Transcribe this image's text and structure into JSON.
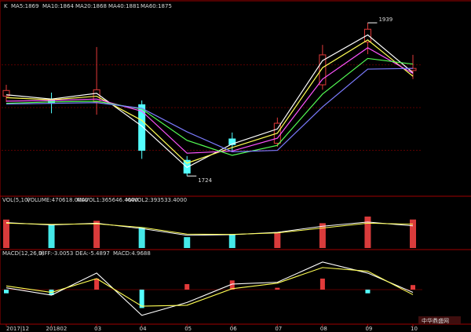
{
  "colors": {
    "up": "#e23a3a",
    "down": "#54ffff",
    "ma5": "#ffffff",
    "ma10": "#ffff54",
    "ma20": "#ff54ff",
    "ma40": "#54ff54",
    "ma60": "#7c7cff",
    "frame": "#a00000",
    "volume_bar_up": "#d93b3b",
    "volume_bar_down": "#44e8e8"
  },
  "main_panel": {
    "legend": {
      "prefix": "K",
      "ma5": "MA5:1869",
      "ma10": "MA10:1864",
      "ma20": "MA20:1868",
      "ma40": "MA40:1881",
      "ma60": "MA60:1875"
    },
    "annotations": {
      "high_label": "1939",
      "low_label": "1724"
    }
  },
  "volume_panel": {
    "legend": {
      "prefix": "VOL(5,10)",
      "volume": "VOLUME:470618.0000",
      "mavol1": "MAVOL1:365646.4000",
      "mavol2": "MAVOL2:393533.4000"
    }
  },
  "macd_panel": {
    "legend": {
      "prefix": "MACD(12,26,9)",
      "diff": "DIFF:-3.0053",
      "dea": "DEA:-5.4897",
      "macd": "MACD:4.9688"
    }
  },
  "x_axis": {
    "ticks": [
      "2017|12",
      "201802",
      "03",
      "04",
      "05",
      "06",
      "07",
      "08",
      "09",
      "10"
    ]
  },
  "watermark": "中华鼎盛网",
  "chart_data": {
    "type": "candlestick",
    "x": [
      "2017|12",
      "201802",
      "03",
      "04",
      "05",
      "06",
      "07",
      "08",
      "09",
      "10"
    ],
    "price_ylim": [
      1700,
      1960
    ],
    "price_markers": [
      {
        "label": "1939",
        "value": 1939,
        "at": "09"
      },
      {
        "label": "1724",
        "value": 1724,
        "at": "05"
      }
    ],
    "price_path_by_month": [
      {
        "x": "2017|12",
        "open": 1836,
        "close": 1844,
        "high": 1852,
        "low": 1828
      },
      {
        "x": "201802",
        "open": 1832,
        "close": 1826,
        "high": 1841,
        "low": 1812
      },
      {
        "x": "03",
        "open": 1828,
        "close": 1845,
        "high": 1905,
        "low": 1810
      },
      {
        "x": "04",
        "open": 1824,
        "close": 1760,
        "high": 1830,
        "low": 1748
      },
      {
        "x": "05",
        "open": 1746,
        "close": 1728,
        "high": 1752,
        "low": 1724
      },
      {
        "x": "06",
        "open": 1776,
        "close": 1768,
        "high": 1785,
        "low": 1758
      },
      {
        "x": "07",
        "open": 1770,
        "close": 1798,
        "high": 1806,
        "low": 1765
      },
      {
        "x": "08",
        "open": 1852,
        "close": 1894,
        "high": 1908,
        "low": 1845
      },
      {
        "x": "09",
        "open": 1912,
        "close": 1930,
        "high": 1939,
        "low": 1895
      },
      {
        "x": "10",
        "open": 1872,
        "close": 1875,
        "high": 1894,
        "low": 1860
      }
    ],
    "series": [
      {
        "name": "MA5",
        "values": [
          1838,
          1832,
          1840,
          1794,
          1736,
          1769,
          1790,
          1886,
          1922,
          1869
        ]
      },
      {
        "name": "MA10",
        "values": [
          1834,
          1831,
          1836,
          1802,
          1742,
          1764,
          1784,
          1876,
          1915,
          1864
        ]
      },
      {
        "name": "MA20",
        "values": [
          1829,
          1830,
          1832,
          1815,
          1756,
          1759,
          1777,
          1860,
          1904,
          1868
        ]
      },
      {
        "name": "MA40",
        "values": [
          1826,
          1828,
          1829,
          1818,
          1774,
          1753,
          1767,
          1839,
          1889,
          1881
        ]
      },
      {
        "name": "MA60",
        "values": [
          1825,
          1826,
          1827,
          1819,
          1786,
          1758,
          1760,
          1821,
          1874,
          1875
        ]
      }
    ],
    "volume": {
      "ylim": [
        0,
        700000
      ],
      "series": [
        {
          "name": "VOLUME",
          "values": [
            470000,
            390000,
            450000,
            340000,
            180000,
            230000,
            250000,
            410000,
            520000,
            470618
          ]
        },
        {
          "name": "MAVOL1",
          "values": [
            420000,
            380000,
            410000,
            320000,
            210000,
            220000,
            260000,
            360000,
            430000,
            365646
          ]
        },
        {
          "name": "MAVOL2",
          "values": [
            410000,
            390000,
            400000,
            340000,
            230000,
            225000,
            250000,
            330000,
            410000,
            393533
          ]
        }
      ]
    },
    "macd": {
      "ylim": [
        -35,
        35
      ],
      "series": [
        {
          "name": "DIFF",
          "values": [
            2,
            -6,
            18,
            -28,
            -14,
            6,
            8,
            30,
            18,
            -3.0053
          ]
        },
        {
          "name": "DEA",
          "values": [
            4,
            -3,
            12,
            -18,
            -17,
            1,
            7,
            24,
            20,
            -5.4897
          ]
        },
        {
          "name": "MACD",
          "values": [
            -4,
            -6,
            12,
            -20,
            6,
            10,
            2,
            12,
            -4,
            4.9688
          ]
        }
      ]
    }
  }
}
